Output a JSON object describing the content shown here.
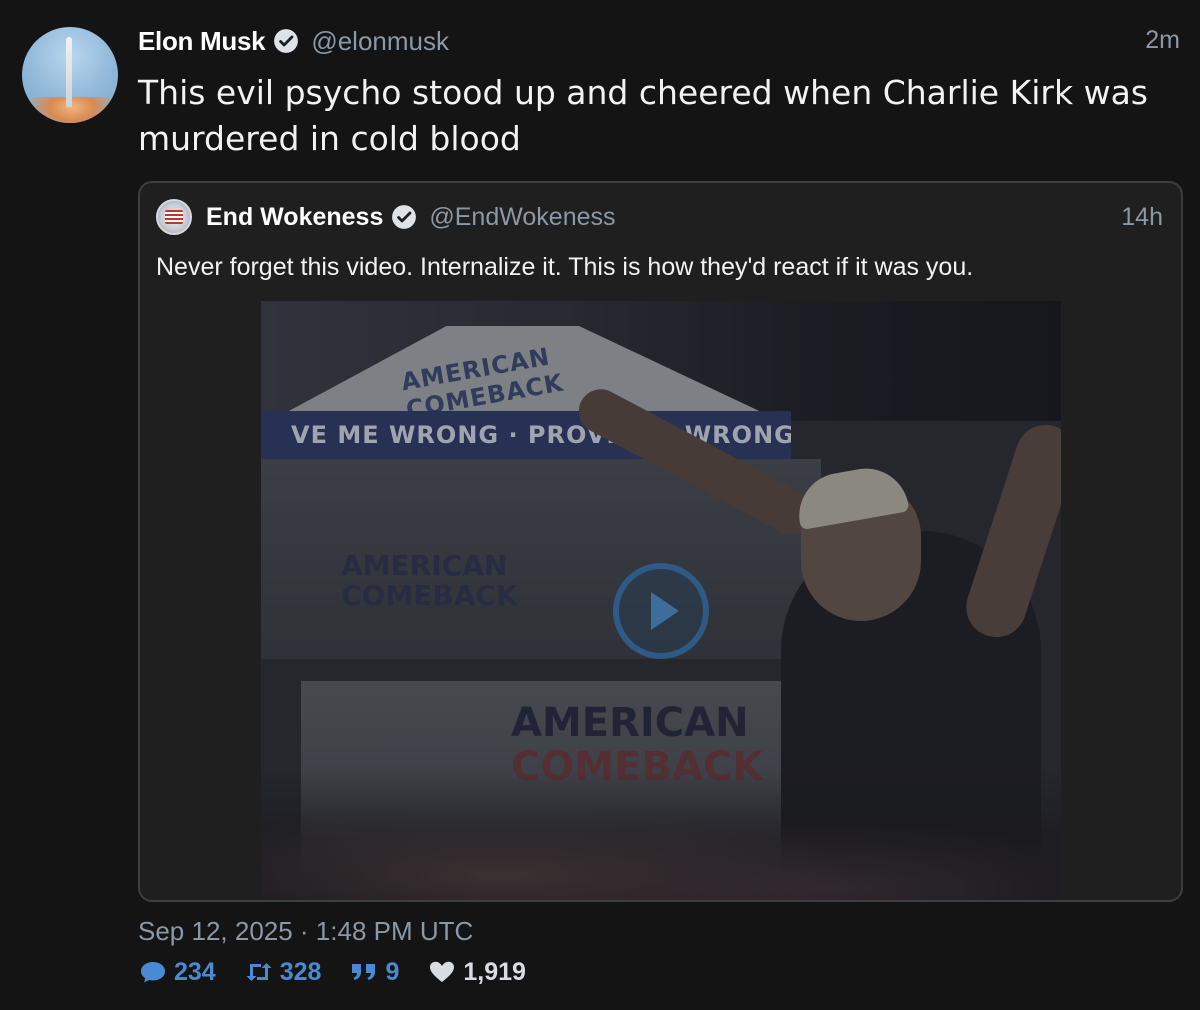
{
  "tweet": {
    "author_name": "Elon Musk",
    "author_handle": "@elonmusk",
    "time": "2m",
    "text": "This evil psycho stood up and cheered when Charlie Kirk was murdered in cold blood",
    "date": "Sep 12, 2025 · 1:48 PM UTC",
    "stats": {
      "replies": "234",
      "retweets": "328",
      "quotes": "9",
      "likes": "1,919"
    }
  },
  "quote": {
    "author_name": "End Wokeness",
    "author_handle": "@EndWokeness",
    "time": "14h",
    "text": "Never forget this video. Internalize it. This is how they'd react if it was you.",
    "video": {
      "tent_logo": "AMERICAN COMEBACK",
      "banner_text": "VE ME WRONG · PROVE ME WRONG",
      "wall_logo": "AMERICAN COMEBACK",
      "barrier_logo_line1": "AMERICAN",
      "barrier_logo_line2": "COMEBACK"
    }
  },
  "colors": {
    "background": "#141414",
    "muted_text": "#8b98a5",
    "verified_blue": "#1d9bf0",
    "stat_blue": "#4a8ad4",
    "quote_border": "#3a3f44"
  },
  "icons": {
    "verified": "verified-badge-icon",
    "reply": "speech-bubble-icon",
    "retweet": "retweet-icon",
    "quote": "quote-marks-icon",
    "like": "heart-icon",
    "play": "play-icon"
  }
}
